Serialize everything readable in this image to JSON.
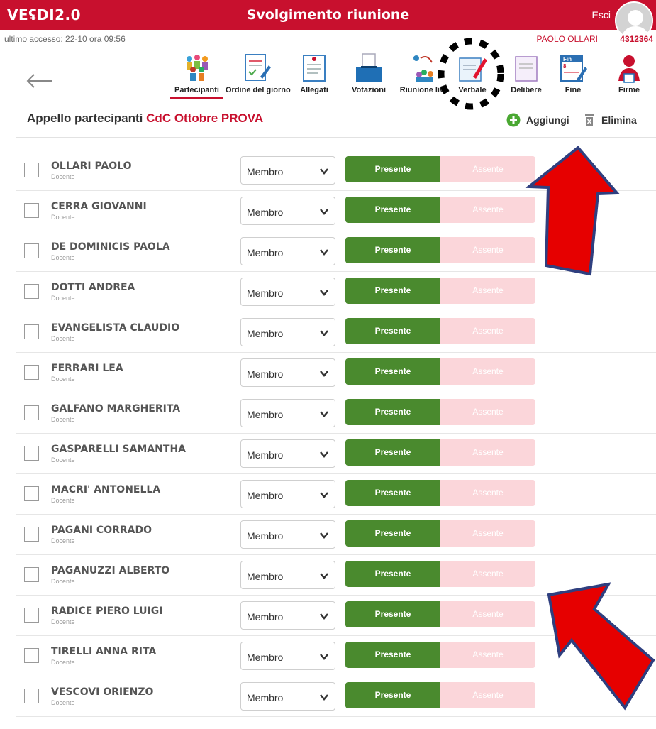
{
  "header": {
    "logo": "VEʢDI2.0",
    "title": "Svolgimento riunione",
    "exit_label": "Esci"
  },
  "info": {
    "last_access": "ultimo accesso: 22-10 ora 09:56",
    "user_name": "PAOLO OLLARI",
    "user_code": "4312364"
  },
  "nav": {
    "items": [
      {
        "label": "Partecipanti",
        "icon": "participants-icon",
        "active": true
      },
      {
        "label": "Ordine del giorno",
        "icon": "agenda-icon"
      },
      {
        "label": "Allegati",
        "icon": "attachments-icon"
      },
      {
        "label": "Votazioni",
        "icon": "ballot-box-icon"
      },
      {
        "label": "Riunione live",
        "icon": "live-meeting-icon"
      },
      {
        "label": "Verbale",
        "icon": "minutes-pen-icon"
      },
      {
        "label": "Delibere",
        "icon": "resolutions-icon"
      },
      {
        "label": "Fine",
        "icon": "calendar-end-icon"
      },
      {
        "label": "Firme",
        "icon": "signature-icon"
      }
    ]
  },
  "section": {
    "title_prefix": "Appello partecipanti",
    "meeting_name": "CdC Ottobre PROVA",
    "add_label": "Aggiungi",
    "delete_label": "Elimina"
  },
  "colors": {
    "brand_red": "#c8102e",
    "present_green": "#4a8a2e",
    "absent_pink": "#fbd6da",
    "annotation_red": "#e60000",
    "annotation_outline": "#2f3f7f"
  },
  "participants": [
    {
      "name": "OLLARI PAOLO",
      "role": "Docente",
      "membership": "Membro",
      "present_label": "Presente",
      "absent_label": "Assente"
    },
    {
      "name": "CERRA GIOVANNI",
      "role": "Docente",
      "membership": "Membro",
      "present_label": "Presente",
      "absent_label": "Assente"
    },
    {
      "name": "DE DOMINICIS PAOLA",
      "role": "Docente",
      "membership": "Membro",
      "present_label": "Presente",
      "absent_label": "Assente"
    },
    {
      "name": "DOTTI ANDREA",
      "role": "Docente",
      "membership": "Membro",
      "present_label": "Presente",
      "absent_label": "Assente"
    },
    {
      "name": "EVANGELISTA CLAUDIO",
      "role": "Docente",
      "membership": "Membro",
      "present_label": "Presente",
      "absent_label": "Assente"
    },
    {
      "name": "FERRARI LEA",
      "role": "Docente",
      "membership": "Membro",
      "present_label": "Presente",
      "absent_label": "Assente"
    },
    {
      "name": "GALFANO MARGHERITA",
      "role": "Docente",
      "membership": "Membro",
      "present_label": "Presente",
      "absent_label": "Assente"
    },
    {
      "name": "GASPARELLI SAMANTHA",
      "role": "Docente",
      "membership": "Membro",
      "present_label": "Presente",
      "absent_label": "Assente"
    },
    {
      "name": "MACRI' ANTONELLA",
      "role": "Docente",
      "membership": "Membro",
      "present_label": "Presente",
      "absent_label": "Assente"
    },
    {
      "name": "PAGANI CORRADO",
      "role": "Docente",
      "membership": "Membro",
      "present_label": "Presente",
      "absent_label": "Assente"
    },
    {
      "name": "PAGANUZZI ALBERTO",
      "role": "Docente",
      "membership": "Membro",
      "present_label": "Presente",
      "absent_label": "Assente"
    },
    {
      "name": "RADICE PIERO LUIGI",
      "role": "Docente",
      "membership": "Membro",
      "present_label": "Presente",
      "absent_label": "Assente"
    },
    {
      "name": "TIRELLI ANNA RITA",
      "role": "Docente",
      "membership": "Membro",
      "present_label": "Presente",
      "absent_label": "Assente"
    },
    {
      "name": "VESCOVI ORIENZO",
      "role": "Docente",
      "membership": "Membro",
      "present_label": "Presente",
      "absent_label": "Assente"
    }
  ]
}
